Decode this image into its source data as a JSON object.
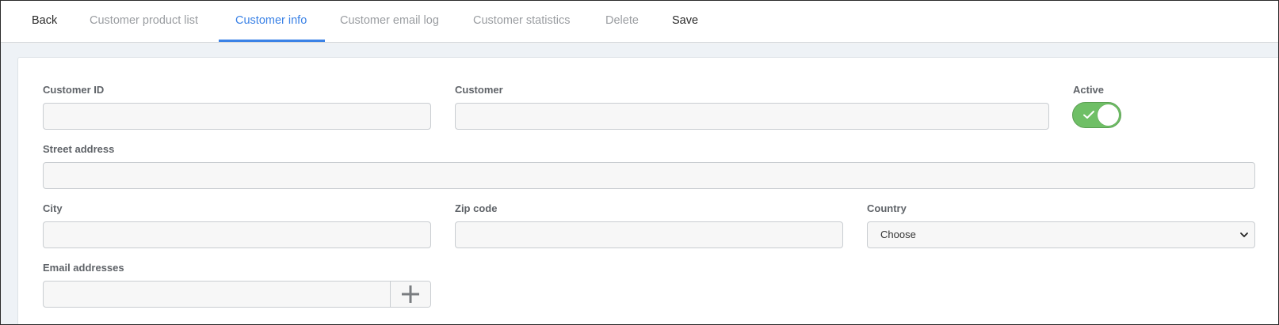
{
  "tabs": [
    {
      "label": "Back"
    },
    {
      "label": "Customer product list"
    },
    {
      "label": "Customer info"
    },
    {
      "label": "Customer email log"
    },
    {
      "label": "Customer statistics"
    },
    {
      "label": "Delete"
    },
    {
      "label": "Save"
    }
  ],
  "active_tab": "Customer info",
  "colors": {
    "accent": "#3b82e6",
    "toggle_on": "#6fbf66",
    "inactive_tab": "#9a9da1",
    "label": "#5f6368"
  },
  "form": {
    "customer_id": {
      "label": "Customer ID",
      "value": ""
    },
    "customer": {
      "label": "Customer",
      "value": ""
    },
    "active": {
      "label": "Active",
      "checked": true,
      "icon": "check-icon"
    },
    "street_address": {
      "label": "Street address",
      "value": ""
    },
    "city": {
      "label": "City",
      "value": ""
    },
    "zip_code": {
      "label": "Zip code",
      "value": ""
    },
    "country": {
      "label": "Country",
      "selected": "Choose",
      "icon": "chevron-down-icon"
    },
    "email_addresses": {
      "label": "Email addresses",
      "value": "",
      "add_icon": "plus-icon"
    }
  }
}
